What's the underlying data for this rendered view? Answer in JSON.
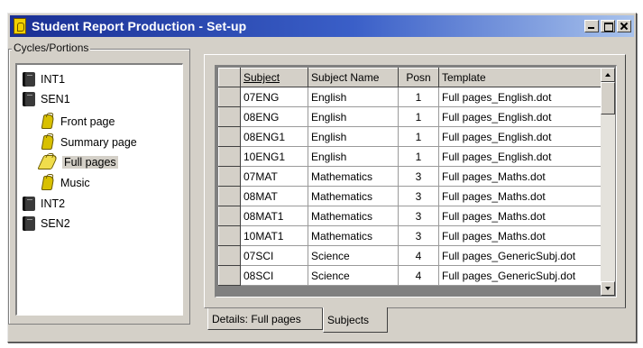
{
  "window": {
    "title": "Student Report Production - Set-up",
    "icon": "app-icon"
  },
  "cycles_group": {
    "label": "Cycles/Portions",
    "tree": [
      {
        "label": "INT1",
        "icon": "book-icon"
      },
      {
        "label": "SEN1",
        "icon": "book-icon"
      },
      {
        "label": "Front page",
        "icon": "page-icon"
      },
      {
        "label": "Summary page",
        "icon": "page-icon"
      },
      {
        "label": "Full pages",
        "icon": "open-page-icon",
        "selected": true
      },
      {
        "label": "Music",
        "icon": "page-icon"
      },
      {
        "label": "INT2",
        "icon": "book-icon"
      },
      {
        "label": "SEN2",
        "icon": "book-icon"
      }
    ]
  },
  "grid": {
    "columns": [
      "Subject",
      "Subject Name",
      "Posn",
      "Template"
    ],
    "rows": [
      [
        "07ENG",
        "English",
        "1",
        "Full pages_English.dot"
      ],
      [
        "08ENG",
        "English",
        "1",
        "Full pages_English.dot"
      ],
      [
        "08ENG1",
        "English",
        "1",
        "Full pages_English.dot"
      ],
      [
        "10ENG1",
        "English",
        "1",
        "Full pages_English.dot"
      ],
      [
        "07MAT",
        "Mathematics",
        "3",
        "Full pages_Maths.dot"
      ],
      [
        "08MAT",
        "Mathematics",
        "3",
        "Full pages_Maths.dot"
      ],
      [
        "08MAT1",
        "Mathematics",
        "3",
        "Full pages_Maths.dot"
      ],
      [
        "10MAT1",
        "Mathematics",
        "3",
        "Full pages_Maths.dot"
      ],
      [
        "07SCI",
        "Science",
        "4",
        "Full pages_GenericSubj.dot"
      ],
      [
        "08SCI",
        "Science",
        "4",
        "Full pages_GenericSubj.dot"
      ]
    ]
  },
  "tabs": {
    "details": "Details: Full pages",
    "subjects": "Subjects"
  }
}
